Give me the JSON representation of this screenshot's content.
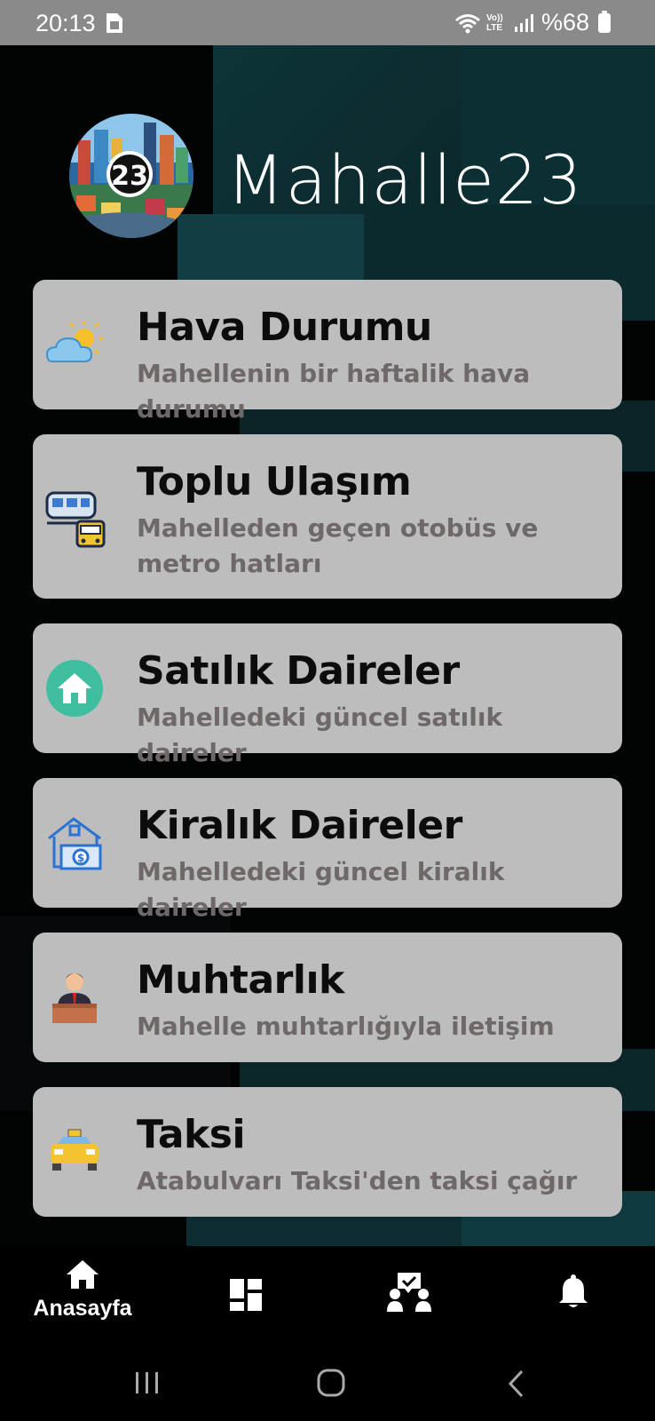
{
  "status_bar": {
    "time": "20:13",
    "network": "Vo)) LTE",
    "battery": "%68"
  },
  "header": {
    "logo_number": "23",
    "app_title": "Mahalle23"
  },
  "cards": [
    {
      "title": "Hava Durumu",
      "subtitle": "Mahellenin bir haftalik hava durumu",
      "icon": "weather-icon"
    },
    {
      "title": "Toplu Ulaşım",
      "subtitle": "Mahelleden geçen otobüs ve metro hatları",
      "icon": "transport-icon"
    },
    {
      "title": "Satılık Daireler",
      "subtitle": "Mahelledeki güncel satılık daireler",
      "icon": "home-icon"
    },
    {
      "title": "Kiralık Daireler",
      "subtitle": "Mahelledeki güncel kiralık daireler",
      "icon": "rent-house-icon"
    },
    {
      "title": "Muhtarlık",
      "subtitle": "Mahelle muhtarlığıyla iletişim",
      "icon": "official-icon"
    },
    {
      "title": "Taksi",
      "subtitle": "Atabulvarı Taksi'den taksi çağır",
      "icon": "taxi-icon"
    }
  ],
  "bottom_nav": {
    "items": [
      {
        "label": "Anasayfa",
        "icon": "home-icon",
        "active": true
      },
      {
        "label": "",
        "icon": "dashboard-icon"
      },
      {
        "label": "",
        "icon": "community-icon"
      },
      {
        "label": "",
        "icon": "bell-icon"
      }
    ]
  },
  "colors": {
    "card_bg": "#bdbdbd",
    "title_text": "#0c0c0c",
    "subtitle_text": "#6f6868",
    "accent_teal": "#0e4a4e"
  }
}
